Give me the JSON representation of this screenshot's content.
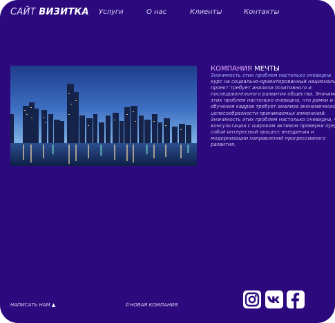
{
  "header": {
    "logo_light": "САЙТ",
    "logo_bold": "ВИЗИТКА",
    "nav": [
      {
        "label": "Услуги"
      },
      {
        "label": "О нас"
      },
      {
        "label": "Клиенты"
      },
      {
        "label": "Контакты"
      }
    ]
  },
  "about": {
    "title_light": "КОМПАНИЯ",
    "title_bold": "МЕЧТЫ",
    "lines": [
      {
        "text": "Значимость этих проблем настолько очевидна",
        "highlight": true
      },
      {
        "text": "курс на социально-ориентированный национальный",
        "highlight": false
      },
      {
        "text": "проект требует анализа позитивного и",
        "highlight": false
      },
      {
        "text": "последовательного развития общества. Значимость",
        "highlight": false
      },
      {
        "text": "этих проблем настолько очевидна, что рамки и место",
        "highlight": false
      },
      {
        "text": "обучения кадров требует анализа экономической",
        "highlight": false
      },
      {
        "text": "целесообразности принимаемых изменений.",
        "highlight": false
      },
      {
        "text": "Значимость этих проблем настолько очевидна, что",
        "highlight": false
      },
      {
        "text": "консультация с широким активом проверки представляет",
        "highlight": false
      },
      {
        "text": "собой интересный процесс внедрения и",
        "highlight": false
      },
      {
        "text": "модернизации направлений прогрессивного",
        "highlight": false
      },
      {
        "text": "развития.",
        "highlight": false
      }
    ]
  },
  "footer": {
    "write_us": "НАПИСАТЬ НАМ",
    "arrow": "▲",
    "copyright": "©НОВАЯ КОМПАНИЯ",
    "social": [
      {
        "icon": "instagram-icon"
      },
      {
        "icon": "vk-icon"
      },
      {
        "icon": "facebook-icon"
      }
    ]
  },
  "colors": {
    "background": "#2c0a7e",
    "accent": "#e6b1ff"
  }
}
